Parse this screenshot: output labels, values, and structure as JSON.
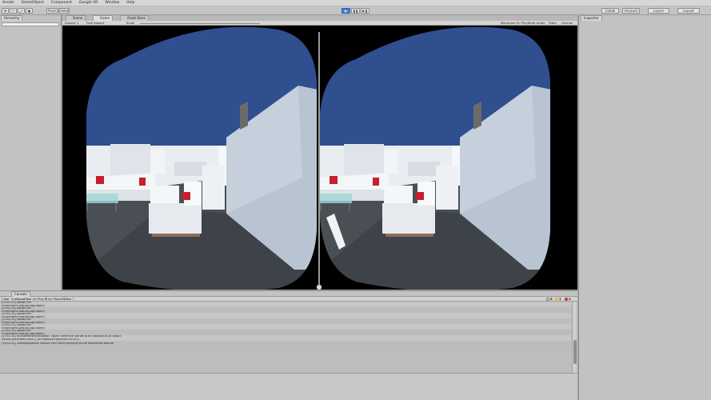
{
  "menu": [
    "Assets",
    "GameObject",
    "Component",
    "Google VR",
    "Window",
    "Help"
  ],
  "toolbar": {
    "transform_tools": [
      "✥",
      "⤧",
      "⤢",
      "▣"
    ],
    "pivot_label": "Pivot",
    "global_label": "Global",
    "play_icon": "▶",
    "pause_icon": "❚❚",
    "step_icon": "▶❚",
    "collab_label": "Collab",
    "account_label": "Account",
    "layers_label": "Layers",
    "layout_label": "Layout"
  },
  "hierarchy": {
    "tab_label": "Hierarchy",
    "create_label": "Create"
  },
  "center_tabs": [
    {
      "label": "Scene",
      "active": false
    },
    {
      "label": "Game",
      "active": true
    },
    {
      "label": "Asset Store",
      "active": false
    }
  ],
  "game_toolbar": {
    "display_label": "Display 1",
    "aspect_label": "Free Aspect",
    "scale_label": "Scale",
    "maximize_label": "Maximize On Play",
    "mute_label": "Mute Audio",
    "stats_label": "Stats",
    "gizmos_label": "Gizmos"
  },
  "inspector": {
    "tab_label": "Inspector"
  },
  "console": {
    "tab_label": "Console",
    "clear_label": "Clear",
    "collapse_label": "Collapse",
    "clear_on_play_label": "Clear on Play",
    "error_pause_label": "Error Pause",
    "editor_label": "Editor",
    "log_count": "5",
    "warn_count": "1",
    "error_count": "2",
    "logs": [
      {
        "line1": "[19:01:31] upload API",
        "line2": "UnityEngine.Debug:Log(Object)"
      },
      {
        "line1": "[19:01:31] upload API",
        "line2": "UnityEngine.Debug:Log(Object)"
      },
      {
        "line1": "[19:01:32] upload API",
        "line2": "UnityEngine.Debug:Log(Object)"
      },
      {
        "line1": "[19:01:32] upload API",
        "line2": "UnityEngine.Debug:Log(Object)"
      },
      {
        "line1": "[19:01:32] upload API",
        "line2": "UnityEngine.Debug:Log(Object)"
      },
      {
        "line1": "[19:01:32] upload API",
        "line2": "UnityEngine.Debug:Log(Object)"
      },
      {
        "line1": "[19:01:32] NullReferenceException: Object reference not set to an instance of an object",
        "line2": "xxxxxx.generated.Main () (at Assets/scripts/Main.cs:102)"
      },
      {
        "line1": "[19:01:32] GetImageResult: texture can't write anything to the destination texture",
        "line2": ""
      }
    ]
  },
  "colors": {
    "sky": "#2f4f8f",
    "wall": "#e9edf2",
    "floor": "#4a4f55",
    "cushion": "#c81e2d",
    "play_active": "#4a7cd0"
  }
}
